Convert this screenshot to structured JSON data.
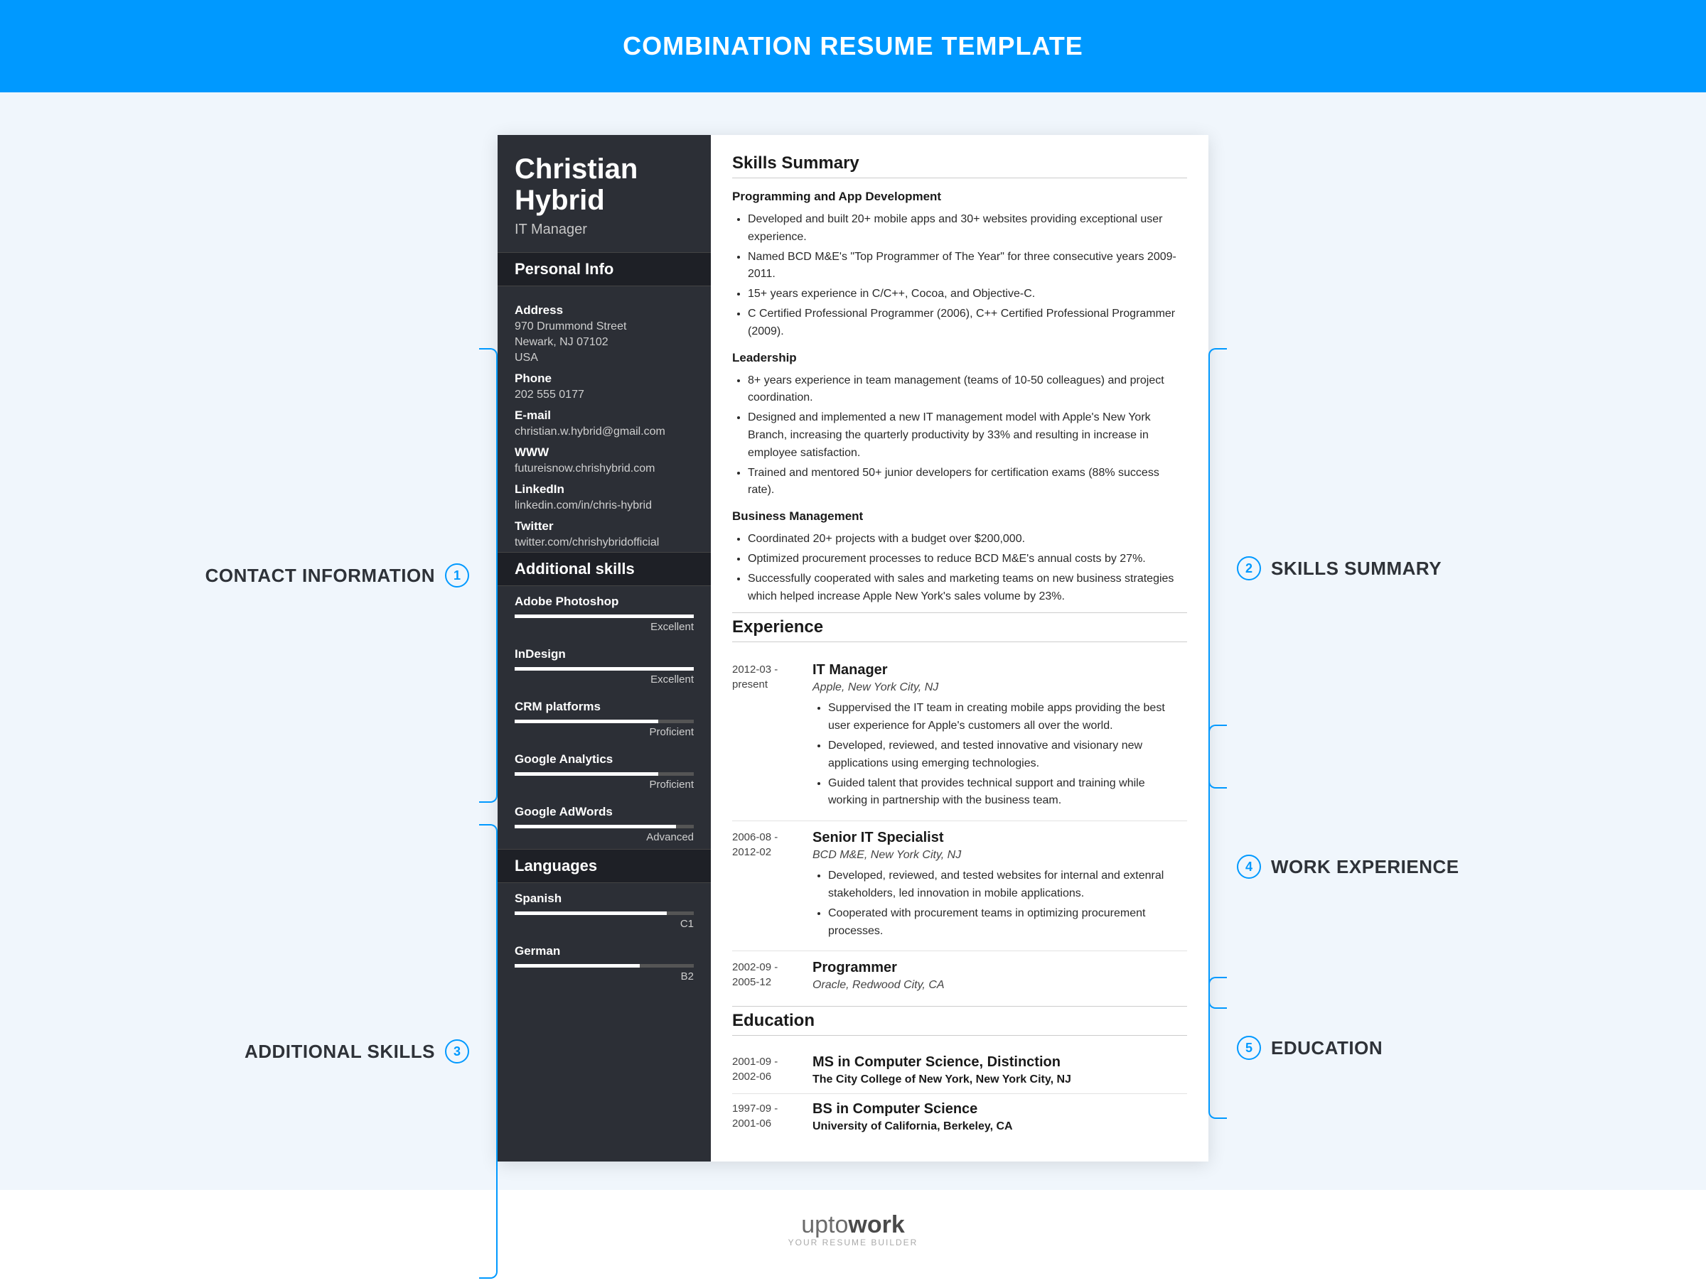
{
  "banner": "COMBINATION RESUME TEMPLATE",
  "annotations": {
    "contact": {
      "num": "1",
      "label": "CONTACT INFORMATION"
    },
    "skills": {
      "num": "2",
      "label": "SKILLS SUMMARY"
    },
    "addskills": {
      "num": "3",
      "label": "ADDITIONAL SKILLS"
    },
    "work": {
      "num": "4",
      "label": "WORK EXPERIENCE"
    },
    "education": {
      "num": "5",
      "label": "EDUCATION"
    }
  },
  "person": {
    "name": "Christian Hybrid",
    "role": "IT Manager"
  },
  "sidebar": {
    "personal_info_hdr": "Personal Info",
    "fields": [
      {
        "label": "Address",
        "vals": [
          "970 Drummond Street",
          "Newark, NJ 07102",
          "USA"
        ]
      },
      {
        "label": "Phone",
        "vals": [
          "202 555 0177"
        ]
      },
      {
        "label": "E-mail",
        "vals": [
          "christian.w.hybrid@gmail.com"
        ]
      },
      {
        "label": "WWW",
        "vals": [
          "futureisnow.chrishybrid.com"
        ]
      },
      {
        "label": "LinkedIn",
        "vals": [
          "linkedin.com/in/chris-hybrid"
        ]
      },
      {
        "label": "Twitter",
        "vals": [
          "twitter.com/chrishybridofficial"
        ]
      }
    ],
    "additional_skills_hdr": "Additional skills",
    "skills": [
      {
        "name": "Adobe Photoshop",
        "level": "Excellent",
        "pct": 100
      },
      {
        "name": "InDesign",
        "level": "Excellent",
        "pct": 100
      },
      {
        "name": "CRM platforms",
        "level": "Proficient",
        "pct": 80
      },
      {
        "name": "Google Analytics",
        "level": "Proficient",
        "pct": 80
      },
      {
        "name": "Google AdWords",
        "level": "Advanced",
        "pct": 90
      }
    ],
    "languages_hdr": "Languages",
    "languages": [
      {
        "name": "Spanish",
        "level": "C1",
        "pct": 85
      },
      {
        "name": "German",
        "level": "B2",
        "pct": 70
      }
    ]
  },
  "main": {
    "skills_summary_hdr": "Skills Summary",
    "groups": [
      {
        "title": "Programming and App Development",
        "items": [
          "Developed and built 20+ mobile apps and 30+ websites providing exceptional user experience.",
          "Named BCD M&E's \"Top Programmer of The Year\" for three consecutive years 2009-2011.",
          "15+ years experience in C/C++, Cocoa, and Objective-C.",
          "C Certified Professional Programmer (2006), C++ Certified Professional Programmer (2009)."
        ]
      },
      {
        "title": "Leadership",
        "items": [
          "8+ years experience in team management (teams of 10-50 colleagues) and project coordination.",
          "Designed and implemented a new IT management model with Apple's New York Branch, increasing the quarterly productivity by 33% and resulting in increase in employee satisfaction.",
          "Trained and mentored 50+ junior developers for certification exams (88% success rate)."
        ]
      },
      {
        "title": "Business Management",
        "items": [
          "Coordinated 20+ projects with a budget over $200,000.",
          "Optimized procurement processes to reduce BCD M&E's annual costs by 27%.",
          "Successfully cooperated with sales and marketing teams on new business strategies which helped increase Apple New York's sales volume by 23%."
        ]
      }
    ],
    "experience_hdr": "Experience",
    "experience": [
      {
        "date": "2012-03 - present",
        "title": "IT Manager",
        "company": "Apple, New York City, NJ",
        "bullets": [
          "Suppervised the IT team in creating mobile apps providing the best user experience for Apple's customers all over the world.",
          "Developed, reviewed, and tested innovative and visionary new applications using emerging technologies.",
          "Guided talent that provides technical support and training while working in partnership with the business team."
        ]
      },
      {
        "date": "2006-08 - 2012-02",
        "title": "Senior IT Specialist",
        "company": "BCD M&E, New York City, NJ",
        "bullets": [
          "Developed, reviewed, and tested websites for internal and extenral stakeholders, led innovation in mobile applications.",
          "Cooperated with procurement teams in optimizing procurement processes."
        ]
      },
      {
        "date": "2002-09 - 2005-12",
        "title": "Programmer",
        "company": "Oracle, Redwood City, CA",
        "bullets": []
      }
    ],
    "education_hdr": "Education",
    "education": [
      {
        "date": "2001-09 - 2002-06",
        "title": "MS in Computer Science, Distinction",
        "school": "The City College of New York, New York City, NJ"
      },
      {
        "date": "1997-09 - 2001-06",
        "title": "BS in Computer Science",
        "school": "University of California, Berkeley, CA"
      }
    ]
  },
  "footer": {
    "brand1": "upto",
    "brand2": "work",
    "tag": "YOUR RESUME BUILDER"
  }
}
